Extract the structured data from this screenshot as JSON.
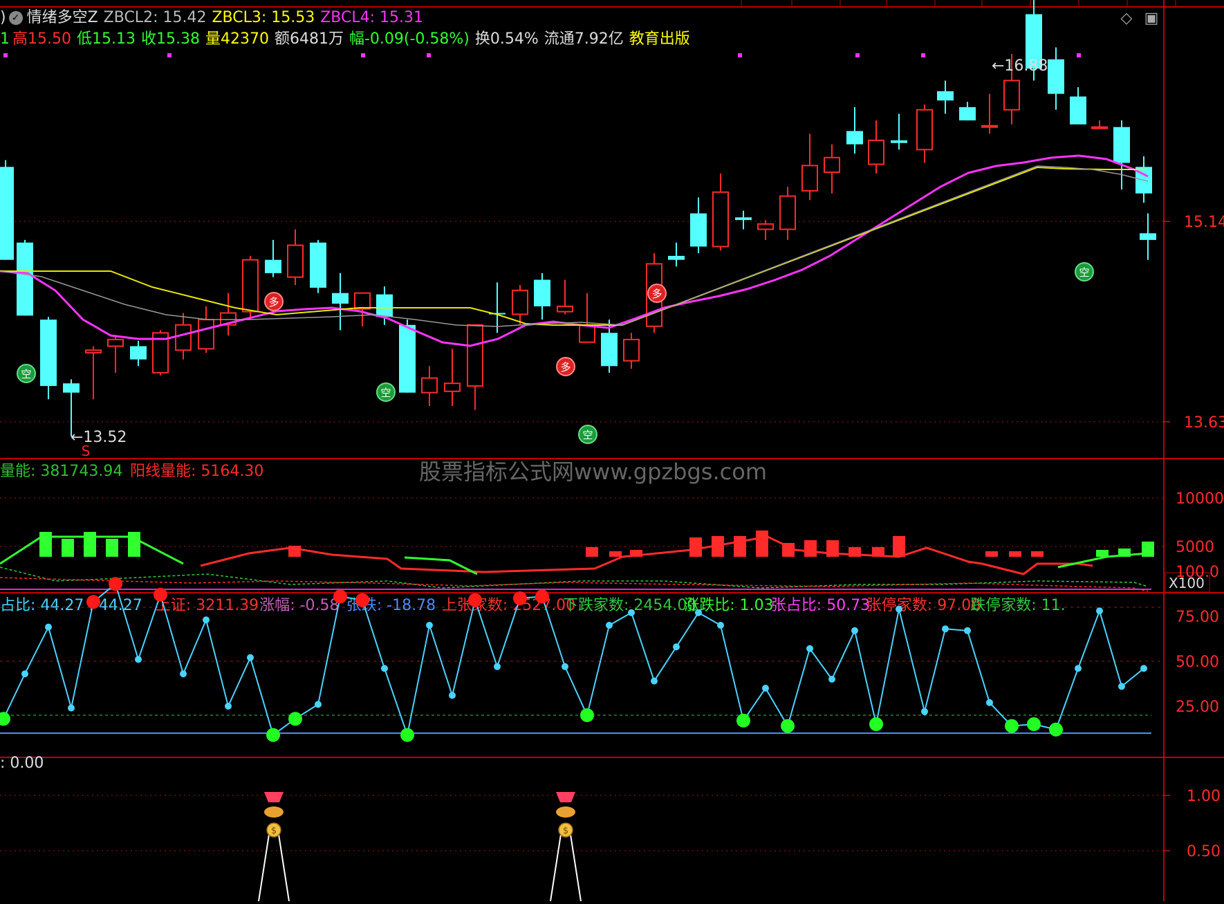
{
  "header": {
    "paren": ")",
    "title": "情绪多空Z",
    "zbcl2": "ZBCL2: 15.42",
    "zbcl3": "ZBCL3: 15.53",
    "zbcl4": "ZBCL4: 15.31",
    "lead": "1",
    "high": "高15.50",
    "low": "低15.13",
    "close": "收15.38",
    "vol": "量42370",
    "amount": "额6481万",
    "change": "幅-0.09(-0.58%)",
    "turnover": "换0.54%",
    "float": "流通7.92亿",
    "sector": "教育出版"
  },
  "main_panel": {
    "price_labels": [
      "15.14",
      "13.63"
    ],
    "high_marker": "16.88",
    "low_marker": "13.52",
    "s_marker": "S",
    "badge_bull": "多",
    "badge_bear": "空"
  },
  "volume_panel": {
    "watermark": "股票指标公式网www.gpzbgs.com",
    "label1": "量能: 381743.94",
    "label2": "阳线量能: 5164.30",
    "axis": [
      "10000",
      "5000"
    ],
    "unit": "X100"
  },
  "breadth_panel": {
    "labels": [
      {
        "text": "占比: 44.27 : 44.27",
        "color": "#4ad3ff"
      },
      {
        "text": "上证: 3211.39",
        "color": "#ff3030"
      },
      {
        "text": "涨幅: -0.58",
        "color": "#c060c0"
      },
      {
        "text": "张跌: -18.78",
        "color": "#4a8cff"
      },
      {
        "text": "上张家数: 2527.00",
        "color": "#ff3030"
      },
      {
        "text": "下跌家数: 2454.00",
        "color": "#2ecc40"
      },
      {
        "text": "涨跌比: 1.03",
        "color": "#30ff30"
      },
      {
        "text": "张占比: 50.73",
        "color": "#ff40ff"
      },
      {
        "text": "张停家数: 97.00",
        "color": "#ff3030"
      },
      {
        "text": "跌停家数: 11.",
        "color": "#2ecc40"
      }
    ],
    "axis": [
      "100.0",
      "75.00",
      "50.00",
      "25.00"
    ]
  },
  "signal_panel": {
    "label": ": 0.00",
    "axis": [
      "1.00",
      "0.50"
    ]
  },
  "colors": {
    "up": "#ff2a2a",
    "down": "#54ffff",
    "ma_main": "#ff33ff",
    "ma_slow": "#e8e800",
    "ma_gray": "#999999",
    "border": "#c00000"
  }
}
